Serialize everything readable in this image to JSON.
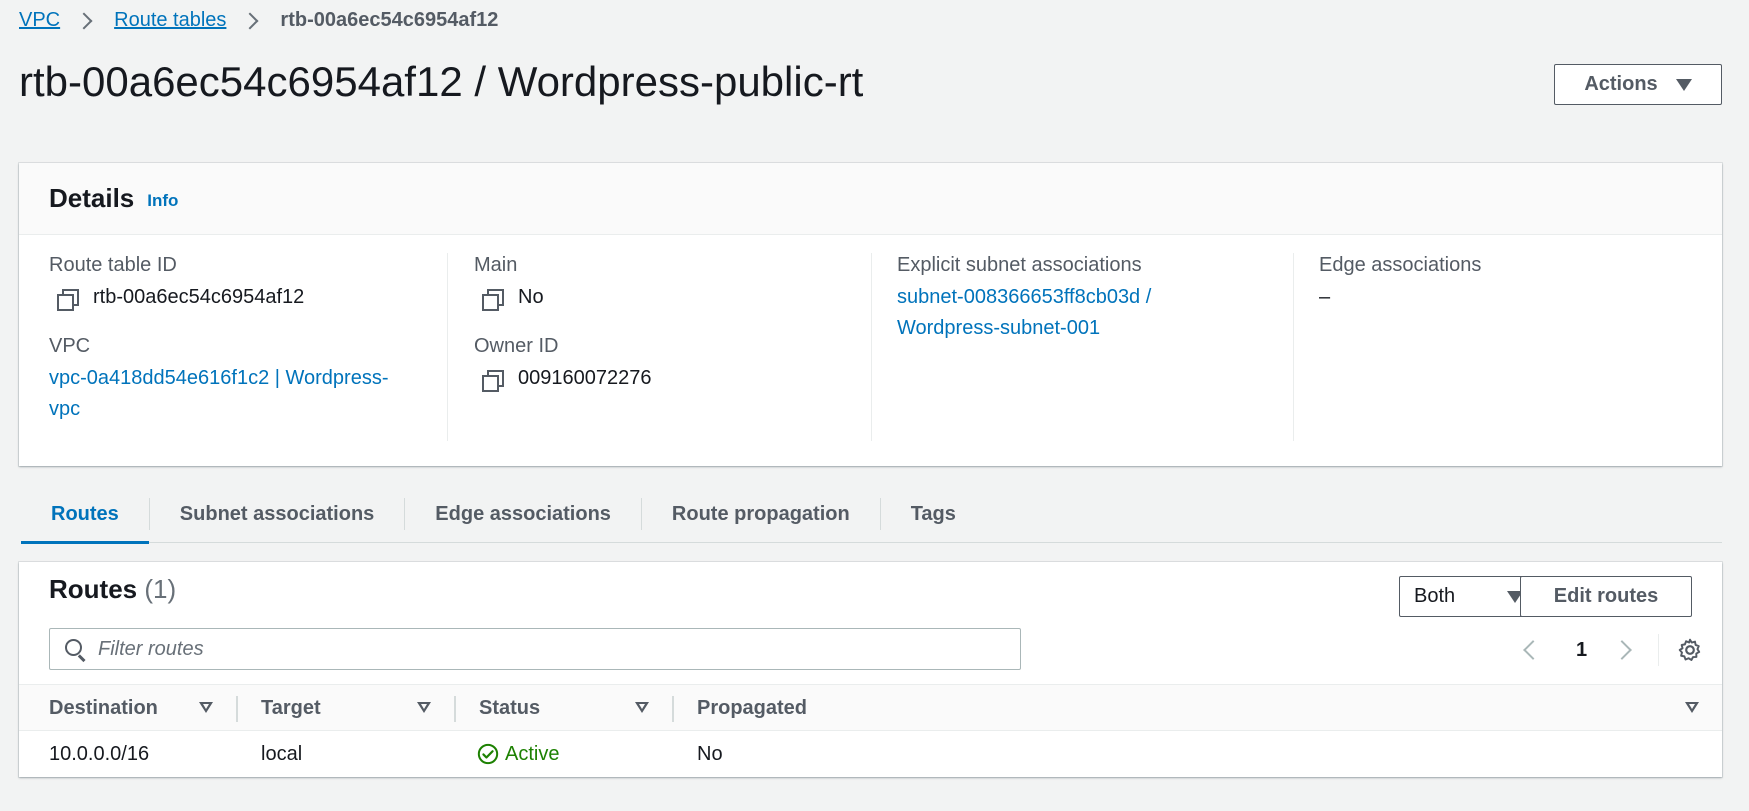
{
  "breadcrumb": {
    "vpc": "VPC",
    "route_tables": "Route tables",
    "current": "rtb-00a6ec54c6954af12"
  },
  "page_title": "rtb-00a6ec54c6954af12 / Wordpress-public-rt",
  "actions_label": "Actions",
  "details": {
    "title": "Details",
    "info": "Info",
    "route_table_id_label": "Route table ID",
    "route_table_id": "rtb-00a6ec54c6954af12",
    "vpc_label": "VPC",
    "vpc_line1": "vpc-0a418dd54e616f1c2 | Wordpress-",
    "vpc_line2": "vpc",
    "main_label": "Main",
    "main_value": "No",
    "owner_label": "Owner ID",
    "owner_value": "009160072276",
    "explicit_label": "Explicit subnet associations",
    "explicit_line1": "subnet-008366653ff8cb03d /",
    "explicit_line2": "Wordpress-subnet-001",
    "edge_label": "Edge associations",
    "edge_value": "–"
  },
  "tabs": [
    "Routes",
    "Subnet associations",
    "Edge associations",
    "Route propagation",
    "Tags"
  ],
  "routes": {
    "title": "Routes",
    "count": "(1)",
    "filter_select": "Both",
    "edit_label": "Edit routes",
    "filter_placeholder": "Filter routes",
    "page": "1",
    "columns": [
      "Destination",
      "Target",
      "Status",
      "Propagated"
    ],
    "rows": [
      {
        "destination": "10.0.0.0/16",
        "target": "local",
        "status": "Active",
        "propagated": "No"
      }
    ]
  },
  "colors": {
    "link": "#0073bb",
    "success": "#1d8102",
    "background": "#f2f3f3"
  }
}
